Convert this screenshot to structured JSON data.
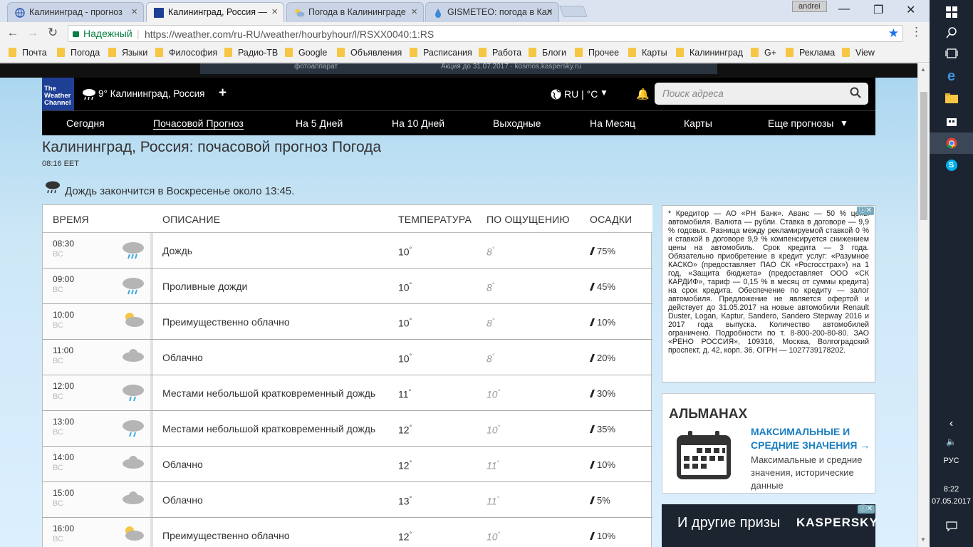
{
  "browser": {
    "tabs": [
      {
        "title": "Калининград - прогноз"
      },
      {
        "title": "Калининград, Россия —"
      },
      {
        "title": "Погода в Калининграде"
      },
      {
        "title": "GISMETEO: погода в Кал"
      }
    ],
    "user": "andrei",
    "secure_label": "Надежный",
    "url": "https://weather.com/ru-RU/weather/hourbyhour/l/RSXX0040:1:RS",
    "bookmarks": [
      "Почта",
      "Погода",
      "Языки",
      "Философия",
      "Радио-ТВ",
      "Google",
      "Объявления",
      "Расписания",
      "Работа",
      "Блоги",
      "Прочее",
      "Карты",
      "Калининград",
      "G+",
      "Реклама",
      "View"
    ]
  },
  "topad": {
    "text1": "фотоаппарат",
    "text2": "Акция до 31.07.2017 · kosmos.kaspersky.ru"
  },
  "header": {
    "logo": "The Weather Channel",
    "location": "9° Калининград, Россия",
    "lang": "RU | °C",
    "search_placeholder": "Поиск адреса"
  },
  "nav": [
    "Сегодня",
    "Почасовой Прогноз",
    "На 5 Дней",
    "На 10 Дней",
    "Выходные",
    "На Месяц",
    "Карты",
    "Еще прогнозы"
  ],
  "page": {
    "title": "Калининград, Россия: почасовой прогноз Погода",
    "time": "08:16 EET",
    "rain_message": "Дождь закончится в Воскресенье около 13:45."
  },
  "table": {
    "headers": [
      "ВРЕМЯ",
      "ОПИСАНИЕ",
      "ТЕМПЕРАТУРА",
      "ПО ОЩУЩЕНИЮ",
      "ОСАДКИ"
    ],
    "rows": [
      {
        "time": "08:30",
        "day": "ВС",
        "icon": "rain-icon",
        "desc": "Дождь",
        "temp": "10",
        "feels": "8",
        "precip": "75%"
      },
      {
        "time": "09:00",
        "day": "ВС",
        "icon": "rain-icon",
        "desc": "Проливные дожди",
        "temp": "10",
        "feels": "8",
        "precip": "45%"
      },
      {
        "time": "10:00",
        "day": "ВС",
        "icon": "partly-cloudy-icon",
        "desc": "Преимущественно облачно",
        "temp": "10",
        "feels": "8",
        "precip": "10%"
      },
      {
        "time": "11:00",
        "day": "ВС",
        "icon": "cloud-icon",
        "desc": "Облачно",
        "temp": "10",
        "feels": "8",
        "precip": "20%"
      },
      {
        "time": "12:00",
        "day": "ВС",
        "icon": "rain-icon",
        "desc": "Местами небольшой кратковременный дождь",
        "temp": "11",
        "feels": "10",
        "precip": "30%"
      },
      {
        "time": "13:00",
        "day": "ВС",
        "icon": "rain-icon",
        "desc": "Местами небольшой кратковременный дождь",
        "temp": "12",
        "feels": "10",
        "precip": "35%"
      },
      {
        "time": "14:00",
        "day": "ВС",
        "icon": "cloud-icon",
        "desc": "Облачно",
        "temp": "12",
        "feels": "11",
        "precip": "10%"
      },
      {
        "time": "15:00",
        "day": "ВС",
        "icon": "cloud-icon",
        "desc": "Облачно",
        "temp": "13",
        "feels": "11",
        "precip": "5%"
      },
      {
        "time": "16:00",
        "day": "ВС",
        "icon": "partly-cloudy-icon",
        "desc": "Преимущественно облачно",
        "temp": "12",
        "feels": "10",
        "precip": "10%"
      }
    ]
  },
  "ad_text": "* Кредитор — АО «РН Банк». Аванс — 50 % цены автомобиля. Валюта — рубли. Ставка в договоре — 9,9 % годовых. Разница между рекламируемой ставкой 0 % и ставкой в договоре 9,9 % компенсируется снижением цены на автомобиль. Срок кредита — 3 года. Обязательно приобретение в кредит услуг: «Разумное КАСКО» (предоставляет ПАО СК «Росгосстрах») на 1 год, «Защита бюджета» (предоставляет ООО «СК КАРДИФ», тариф — 0,15 % в месяц от суммы кредита) на срок кредита. Обеспечение по кредиту — залог автомобиля. Предложение не является офертой и действует до 31.05.2017 на новые автомобили Renault Duster, Logan, Kaptur, Sandero, Sandero Stepway 2016 и 2017 года выпуска. Количество автомобилей ограничено. Подробности по т. 8-800-200-80-80. ЗАО «РЕНО РОССИЯ», 109316, Москва, Волгоградский проспект, д. 42, корп. 36. ОГРН — 1027739178202.",
  "almanac": {
    "title": "АЛЬМАНАХ",
    "link": "МАКСИМАЛЬНЫЕ И СРЕДНИЕ ЗНАЧЕНИЯ →",
    "sub": "Максимальные и средние значения, исторические данные"
  },
  "ad2": {
    "text": "И другие призы",
    "brand": "KASPERSKY"
  },
  "taskbar": {
    "lang": "РУС",
    "time": "8:22",
    "date": "07.05.2017"
  }
}
